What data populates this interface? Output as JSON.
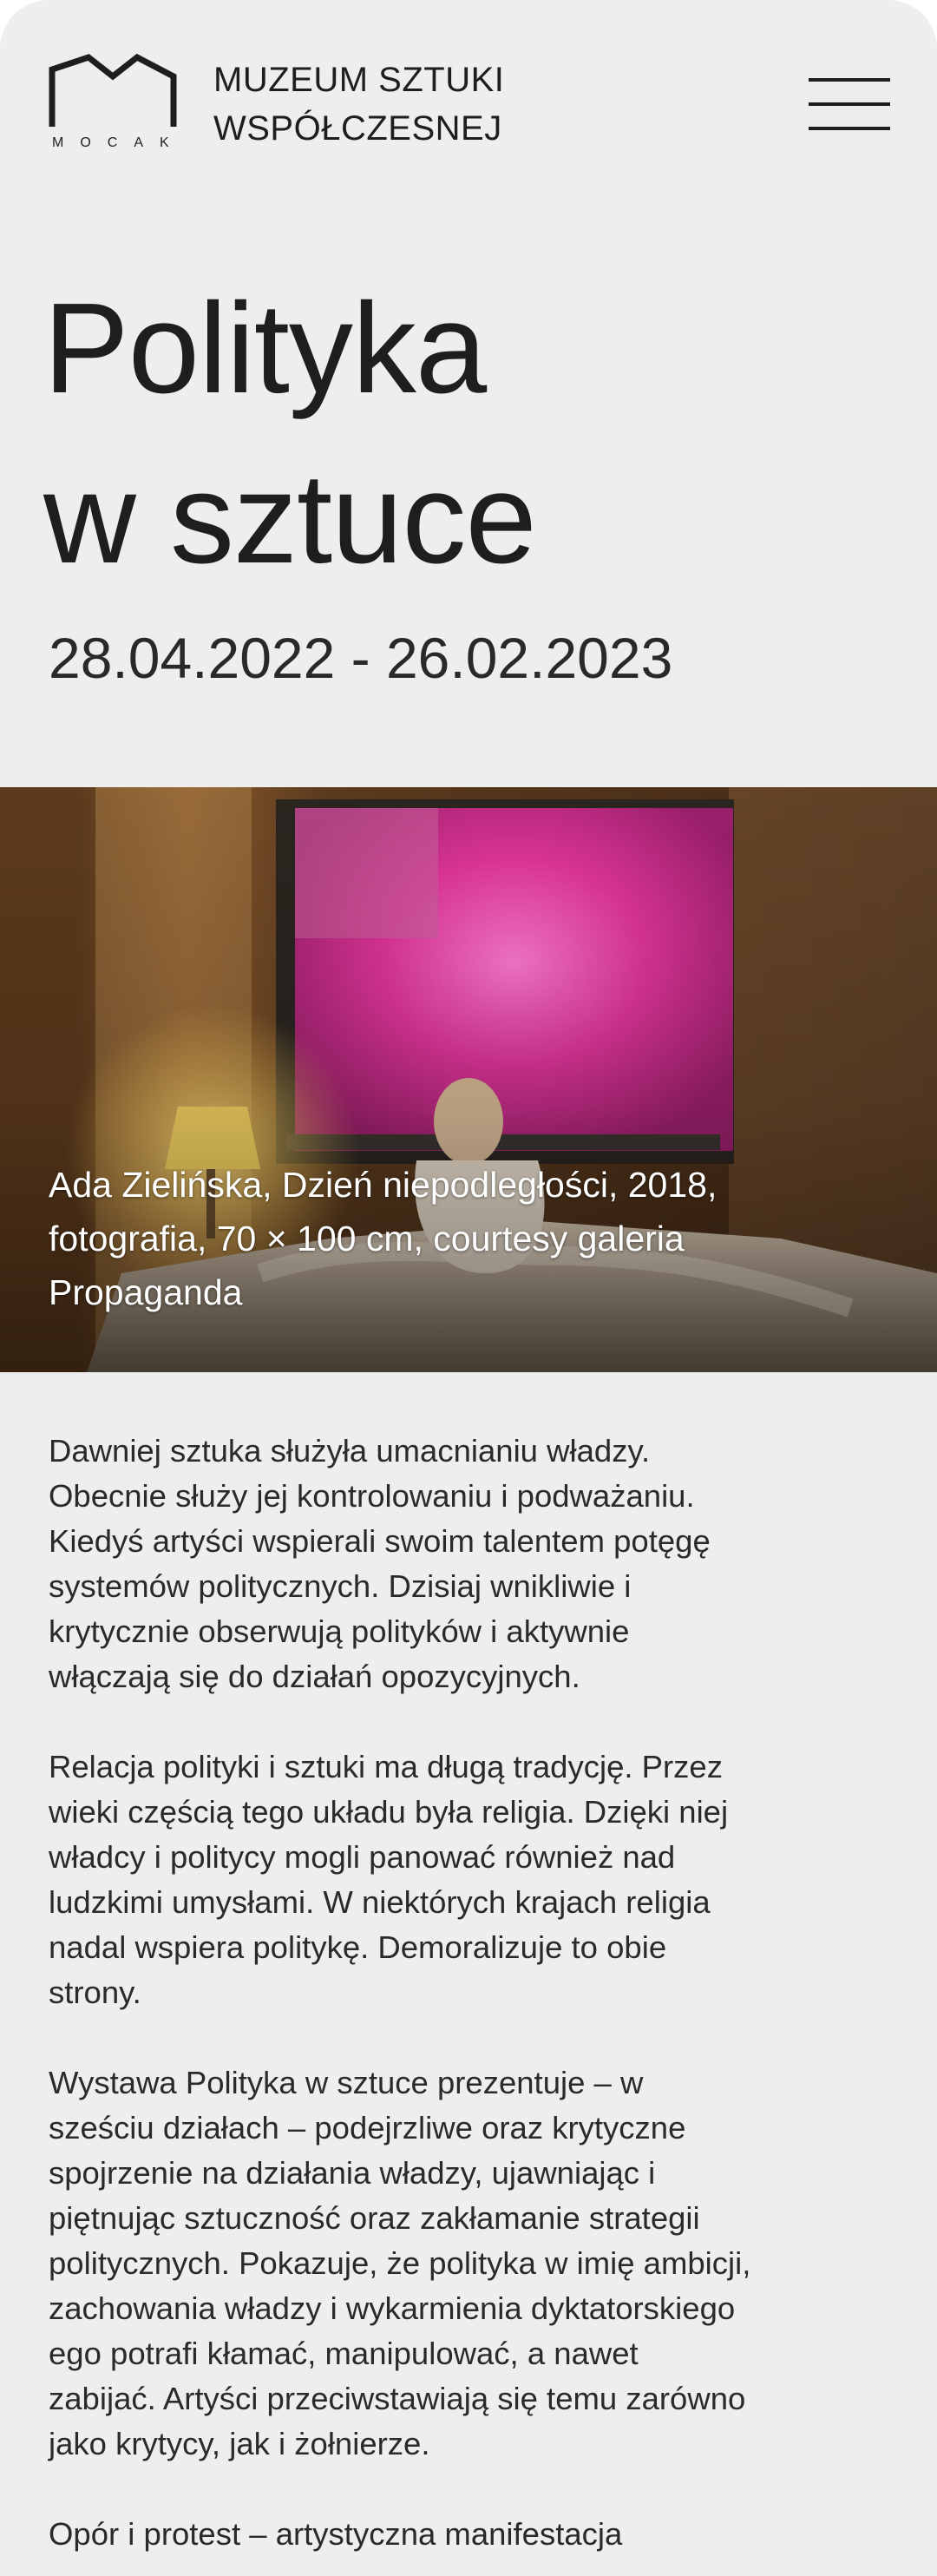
{
  "header": {
    "logo_letters": "MOCAK",
    "museum_name_line1": "MUZEUM SZTUKI",
    "museum_name_line2": "WSPÓŁCZESNEJ"
  },
  "exhibition": {
    "title_line1": "Polityka",
    "title_line2": "w sztuce",
    "dates": "28.04.2022 - 26.02.2023"
  },
  "hero": {
    "caption_line1": "Ada Zielińska, Dzień niepodległości, 2018,",
    "caption_line2": "fotografia, 70 × 100 cm, courtesy galeria",
    "caption_line3": "Propaganda"
  },
  "description": {
    "p1": [
      "Dawniej sztuka służyła umacnianiu władzy.",
      "Obecnie służy jej kontrolowaniu i podważaniu.",
      "Kiedyś artyści wspierali swoim talentem potęgę",
      "systemów politycznych. Dzisiaj wnikliwie i",
      "krytycznie obserwują polityków i aktywnie",
      "włączają się do działań opozycyjnych."
    ],
    "p2": [
      "Relacja polityki i sztuki ma długą tradycję. Przez",
      "wieki częścią tego układu była religia. Dzięki niej",
      "władcy i politycy mogli panować również nad",
      "ludzkimi umysłami. W niektórych krajach religia",
      "nadal wspiera politykę. Demoralizuje to obie",
      "strony."
    ],
    "p3": [
      "Wystawa Polityka w sztuce prezentuje – w",
      "sześciu działach – podejrzliwe oraz krytyczne",
      "spojrzenie na działania władzy, ujawniając i",
      "piętnując sztuczność oraz zakłamanie strategii",
      "politycznych. Pokazuje, że polityka w imię ambicji,",
      "zachowania władzy i wykarmienia dyktatorskiego",
      "ego potrafi kłamać, manipulować, a nawet",
      "zabijać. Artyści przeciwstawiają się temu zarówno",
      "jako krytycy, jak i żołnierze."
    ],
    "p4": [
      "Opór i protest – artystyczna manifestacja"
    ]
  },
  "colors": {
    "background": "#eeeeee",
    "text": "#1f1d1d",
    "caption_text": "#ffffff"
  },
  "icons": {
    "logo": "mocak-roof-logo",
    "menu": "hamburger-menu-icon"
  }
}
